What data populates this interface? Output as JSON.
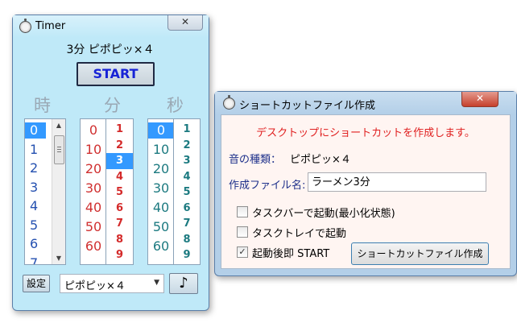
{
  "timer_window": {
    "title": "Timer",
    "close_glyph": "✕",
    "sound_title": "3分 ピポピッ×４",
    "start_label": "START",
    "col_headers": {
      "hours": "時",
      "minutes": "分",
      "seconds": "秒"
    },
    "hours": {
      "items": [
        "0",
        "1",
        "2",
        "3",
        "4",
        "5",
        "6",
        "7"
      ],
      "selected": "0"
    },
    "minutes_tens": {
      "items": [
        "0",
        "10",
        "20",
        "30",
        "40",
        "50",
        "60"
      ]
    },
    "minutes_units": {
      "items": [
        "1",
        "2",
        "3",
        "4",
        "5",
        "6",
        "7",
        "8",
        "9"
      ],
      "selected": "3"
    },
    "seconds_tens": {
      "items": [
        "0",
        "10",
        "20",
        "30",
        "40",
        "50",
        "60"
      ],
      "selected": "0"
    },
    "seconds_units": {
      "items": [
        "1",
        "2",
        "3",
        "4",
        "5",
        "6",
        "7",
        "8",
        "9"
      ]
    },
    "settings_label": "設定",
    "sound_select": "ピポピッ×４",
    "play_glyph": "♪",
    "scroll_up_glyph": "▲",
    "scroll_down_glyph": "▼",
    "combo_arrow_glyph": "▼"
  },
  "shortcut_window": {
    "title": "ショートカットファイル作成",
    "close_glyph": "✕",
    "header": "デスクトップにショートカットを作成します。",
    "sound_type_label": "音の種類：",
    "sound_type_value": "ピポピッ×４",
    "filename_label": "作成ファイル名:",
    "filename_value": "ラーメン3分",
    "options": [
      {
        "label": "タスクバーで起動(最小化状態)",
        "checked": false
      },
      {
        "label": "タスクトレイで起動",
        "checked": false
      },
      {
        "label": "起動後即 START",
        "checked": true
      }
    ],
    "check_glyph": "✓",
    "create_button": "ショートカットファイル作成"
  },
  "colors": {
    "timer_bg": "#bfe9f8",
    "selected": "#3399ff",
    "minutes_units": "#d42a2a",
    "minutes_tens": "#d03030",
    "seconds": "#1c7a80",
    "hours": "#2450b0",
    "header_text": "#e02020",
    "start_text": "#1723d6"
  },
  "icons": [
    "timer-icon",
    "close-icon",
    "scroll-up-icon",
    "scroll-down-icon",
    "dropdown-icon",
    "music-note-icon",
    "checkbox-icon"
  ]
}
